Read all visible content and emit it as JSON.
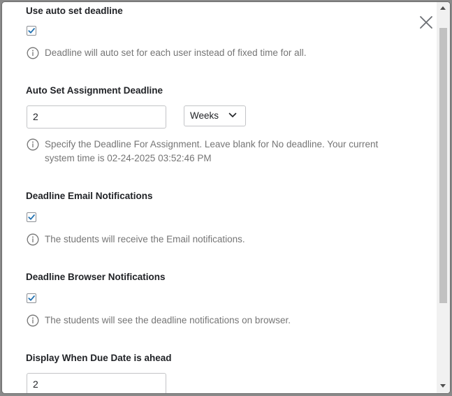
{
  "sections": {
    "auto_set": {
      "title": "Use auto set deadline",
      "checked": true,
      "help": "Deadline will auto set for each user instead of fixed time for all."
    },
    "assignment_deadline": {
      "title": "Auto Set Assignment Deadline",
      "value": "2",
      "unit": "Weeks",
      "help": "Specify the Deadline For Assignment. Leave blank for No deadline. Your current system time is 02-24-2025 03:52:46 PM"
    },
    "email_notifications": {
      "title": "Deadline Email Notifications",
      "checked": true,
      "help": "The students will receive the Email notifications."
    },
    "browser_notifications": {
      "title": "Deadline Browser Notifications",
      "checked": true,
      "help": "The students will see the deadline notifications on browser."
    },
    "due_date_ahead": {
      "title": "Display When Due Date is ahead",
      "value": "2"
    }
  },
  "icons": {
    "close": "close-icon",
    "info": "info-icon",
    "check": "checkmark-icon",
    "chevron": "chevron-down-icon"
  },
  "colors": {
    "check": "#2271b1",
    "text": "#212327",
    "muted": "#757575",
    "border": "#c3c4c7"
  }
}
